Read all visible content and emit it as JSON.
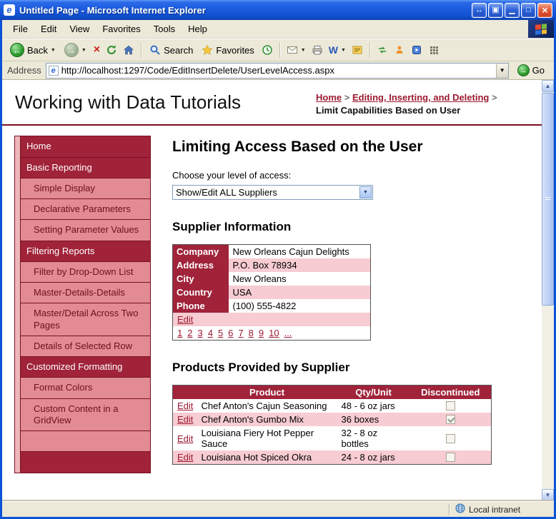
{
  "colors": {
    "accent": "#a0233a",
    "dark_border": "#7a1022",
    "sidebar_sub": "#e28b92",
    "sidebar_strip": "#edb6bb",
    "row_alt": "#f7ccd2",
    "link": "#9c1a31"
  },
  "window": {
    "title": "Untitled Page - Microsoft Internet Explorer"
  },
  "menu_bar": {
    "items": [
      "File",
      "Edit",
      "View",
      "Favorites",
      "Tools",
      "Help"
    ]
  },
  "toolbar": {
    "back_label": "Back",
    "search_label": "Search",
    "favorites_label": "Favorites"
  },
  "address_bar": {
    "label": "Address",
    "url": "http://localhost:1297/Code/EditInsertDelete/UserLevelAccess.aspx",
    "go_label": "Go"
  },
  "page": {
    "site_title": "Working with Data Tutorials",
    "breadcrumb": {
      "links": [
        "Home",
        "Editing, Inserting, and Deleting"
      ],
      "separator": " > ",
      "current": "Limit Capabilities Based on User"
    }
  },
  "sidebar": {
    "items": [
      {
        "label": "Home",
        "type": "section"
      },
      {
        "label": "Basic Reporting",
        "type": "section"
      },
      {
        "label": "Simple Display",
        "type": "sub"
      },
      {
        "label": "Declarative Parameters",
        "type": "sub"
      },
      {
        "label": "Setting Parameter Values",
        "type": "sub"
      },
      {
        "label": "Filtering Reports",
        "type": "section"
      },
      {
        "label": "Filter by Drop-Down List",
        "type": "sub"
      },
      {
        "label": "Master-Details-Details",
        "type": "sub"
      },
      {
        "label": "Master/Detail Across Two Pages",
        "type": "sub"
      },
      {
        "label": "Details of Selected Row",
        "type": "sub"
      },
      {
        "label": "Customized Formatting",
        "type": "section"
      },
      {
        "label": "Format Colors",
        "type": "sub"
      },
      {
        "label": "Custom Content in a GridView",
        "type": "sub"
      },
      {
        "label": "",
        "type": "sub"
      },
      {
        "label": "",
        "type": "section"
      }
    ]
  },
  "main": {
    "title": "Limiting Access Based on the User",
    "access_label": "Choose your level of access:",
    "access_dropdown": {
      "selected": "Show/Edit ALL Suppliers"
    },
    "supplier_section": {
      "heading": "Supplier Information",
      "fields": [
        {
          "label": "Company",
          "value": "New Orleans Cajun Delights"
        },
        {
          "label": "Address",
          "value": "P.O. Box 78934"
        },
        {
          "label": "City",
          "value": "New Orleans"
        },
        {
          "label": "Country",
          "value": "USA"
        },
        {
          "label": "Phone",
          "value": "(100) 555-4822"
        }
      ],
      "edit_label": "Edit",
      "pager": [
        "1",
        "2",
        "3",
        "4",
        "5",
        "6",
        "7",
        "8",
        "9",
        "10",
        "..."
      ]
    },
    "products_section": {
      "heading": "Products Provided by Supplier",
      "columns": [
        "Product",
        "Qty/Unit",
        "Discontinued"
      ],
      "edit_label": "Edit",
      "rows": [
        {
          "product": "Chef Anton's Cajun Seasoning",
          "qty": "48 - 6 oz jars",
          "discontinued": false
        },
        {
          "product": "Chef Anton's Gumbo Mix",
          "qty": "36 boxes",
          "discontinued": true
        },
        {
          "product": "Louisiana Fiery Hot Pepper Sauce",
          "qty": "32 - 8 oz bottles",
          "discontinued": false
        },
        {
          "product": "Louisiana Hot Spiced Okra",
          "qty": "24 - 8 oz jars",
          "discontinued": false
        }
      ]
    }
  },
  "status_bar": {
    "zone": "Local intranet"
  }
}
